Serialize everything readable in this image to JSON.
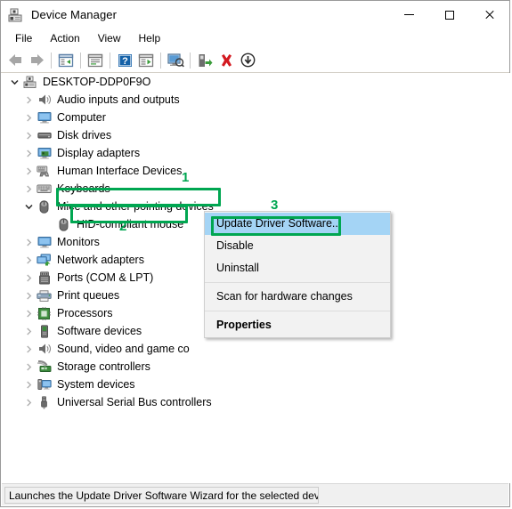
{
  "window": {
    "title": "Device Manager",
    "app_icon": "device-manager-icon",
    "controls": {
      "minimize": "minimize-icon",
      "maximize": "maximize-icon",
      "close": "close-icon"
    }
  },
  "menubar": {
    "items": [
      {
        "label": "File"
      },
      {
        "label": "Action"
      },
      {
        "label": "View"
      },
      {
        "label": "Help"
      }
    ]
  },
  "toolbar": {
    "buttons": [
      {
        "icon": "back-arrow-icon",
        "title": "Back"
      },
      {
        "icon": "forward-arrow-icon",
        "title": "Forward"
      },
      {
        "icon": "show-hide-console-tree-icon",
        "title": "Show/Hide Console Tree"
      },
      {
        "icon": "properties-icon",
        "title": "Properties"
      },
      {
        "icon": "help-icon",
        "title": "Help"
      },
      {
        "icon": "scan-for-hardware-changes-icon",
        "title": "Scan for hardware changes"
      },
      {
        "icon": "update-driver-software-icon",
        "title": "Update Driver Software"
      },
      {
        "icon": "enable-device-icon",
        "title": "Enable device"
      },
      {
        "icon": "uninstall-device-icon",
        "title": "Uninstall device"
      },
      {
        "icon": "disable-device-icon",
        "title": "Disable device"
      }
    ]
  },
  "tree": {
    "root": {
      "label": "DESKTOP-DDP0F9O",
      "icon": "computer-root-icon",
      "expanded": true
    },
    "nodes": [
      {
        "label": "Audio inputs and outputs",
        "icon": "speaker-icon",
        "expandable": true,
        "expanded": false,
        "indent": 1
      },
      {
        "label": "Computer",
        "icon": "monitor-icon",
        "expandable": true,
        "expanded": false,
        "indent": 1
      },
      {
        "label": "Disk drives",
        "icon": "disk-drive-icon",
        "expandable": true,
        "expanded": false,
        "indent": 1
      },
      {
        "label": "Display adapters",
        "icon": "display-adapter-icon",
        "expandable": true,
        "expanded": false,
        "indent": 1
      },
      {
        "label": "Human Interface Devices",
        "icon": "hid-icon",
        "expandable": true,
        "expanded": false,
        "indent": 1
      },
      {
        "label": "Keyboards",
        "icon": "keyboard-icon",
        "expandable": true,
        "expanded": false,
        "indent": 1
      },
      {
        "label": "Mice and other pointing devices",
        "icon": "mouse-icon",
        "expandable": true,
        "expanded": true,
        "indent": 1
      },
      {
        "label": "HID-compliant mouse",
        "icon": "mouse-icon",
        "expandable": false,
        "expanded": false,
        "indent": 2
      },
      {
        "label": "Monitors",
        "icon": "monitor-icon",
        "expandable": true,
        "expanded": false,
        "indent": 1
      },
      {
        "label": "Network adapters",
        "icon": "network-adapter-icon",
        "expandable": true,
        "expanded": false,
        "indent": 1
      },
      {
        "label": "Ports (COM & LPT)",
        "icon": "port-icon",
        "expandable": true,
        "expanded": false,
        "indent": 1
      },
      {
        "label": "Print queues",
        "icon": "printer-icon",
        "expandable": true,
        "expanded": false,
        "indent": 1
      },
      {
        "label": "Processors",
        "icon": "processor-icon",
        "expandable": true,
        "expanded": false,
        "indent": 1
      },
      {
        "label": "Software devices",
        "icon": "software-device-icon",
        "expandable": true,
        "expanded": false,
        "indent": 1
      },
      {
        "label": "Sound, video and game co",
        "icon": "speaker-icon",
        "expandable": true,
        "expanded": false,
        "indent": 1
      },
      {
        "label": "Storage controllers",
        "icon": "storage-controller-icon",
        "expandable": true,
        "expanded": false,
        "indent": 1
      },
      {
        "label": "System devices",
        "icon": "system-device-icon",
        "expandable": true,
        "expanded": false,
        "indent": 1
      },
      {
        "label": "Universal Serial Bus controllers",
        "icon": "usb-icon",
        "expandable": true,
        "expanded": false,
        "indent": 1
      }
    ]
  },
  "context_menu": {
    "items": [
      {
        "label": "Update Driver Software...",
        "highlighted": true,
        "bold": false
      },
      {
        "label": "Disable",
        "highlighted": false,
        "bold": false
      },
      {
        "label": "Uninstall",
        "highlighted": false,
        "bold": false
      },
      {
        "separator": true
      },
      {
        "label": "Scan for hardware changes",
        "highlighted": false,
        "bold": false
      },
      {
        "separator": true
      },
      {
        "label": "Properties",
        "highlighted": false,
        "bold": true
      }
    ]
  },
  "annotations": {
    "accent_color": "#00a651",
    "markers": [
      {
        "number": "1",
        "target": "Mice and other pointing devices"
      },
      {
        "number": "2",
        "target": "HID-compliant mouse"
      },
      {
        "number": "3",
        "target": "Update Driver Software..."
      }
    ]
  },
  "statusbar": {
    "text": "Launches the Update Driver Software Wizard for the selected device"
  }
}
